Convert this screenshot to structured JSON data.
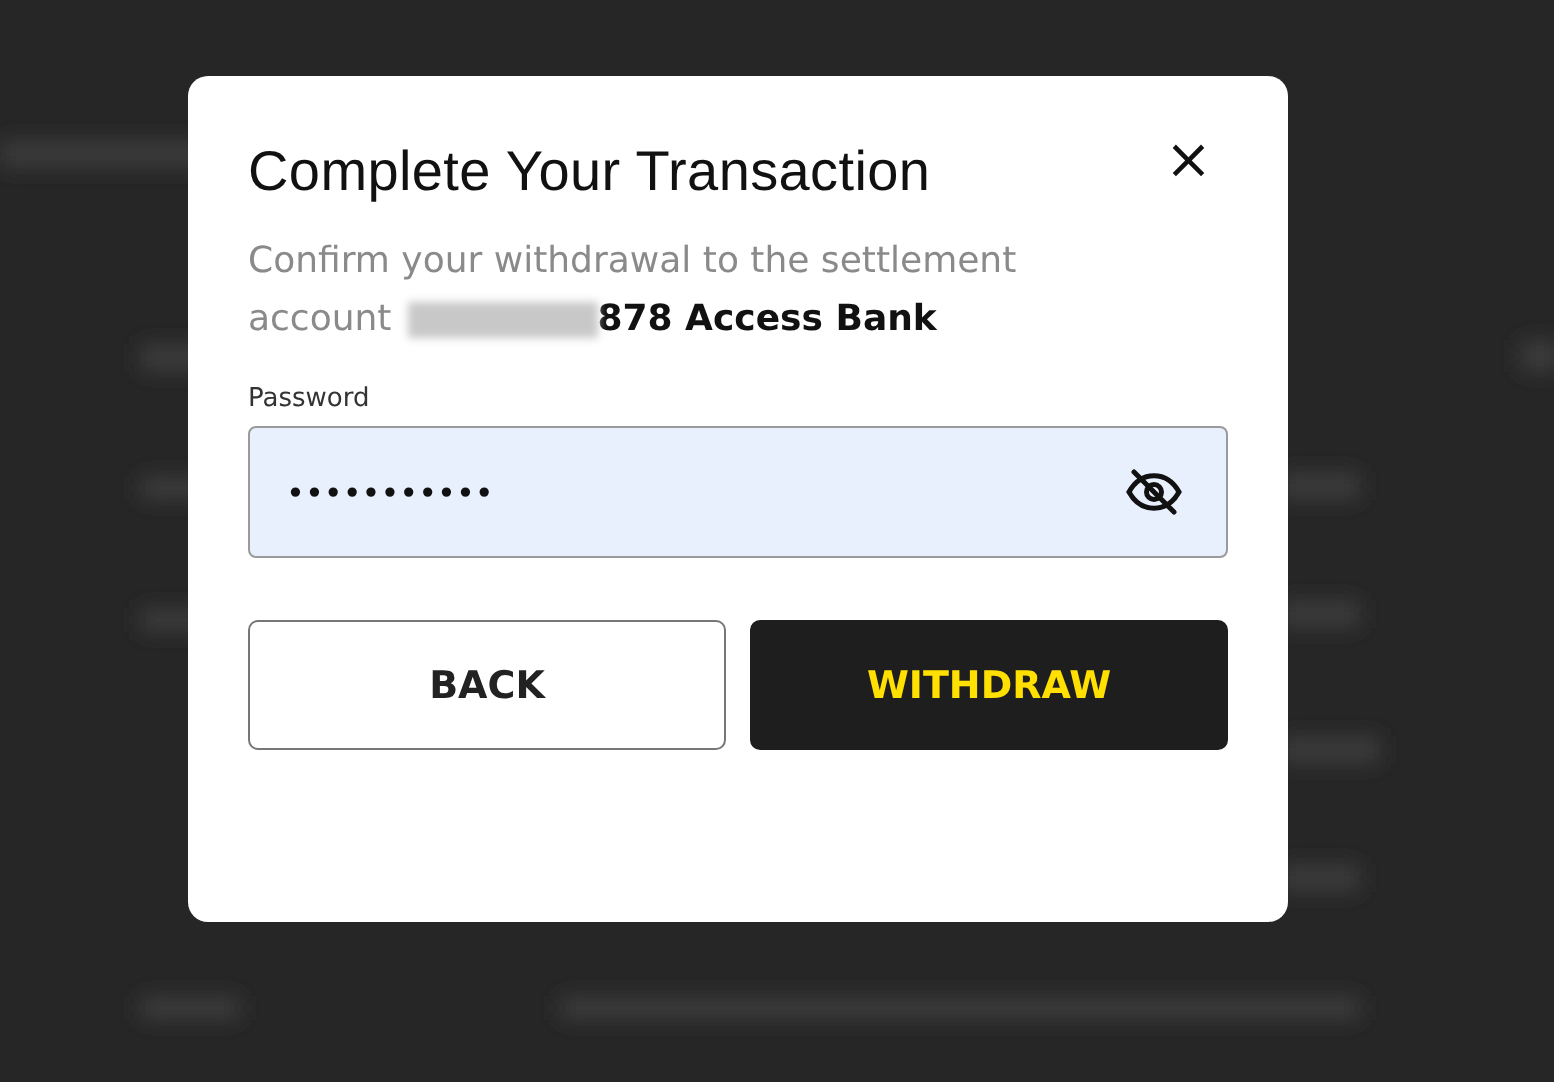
{
  "dialog": {
    "title": "Complete Your Transaction",
    "close_icon": "×",
    "message_lines": [
      "Confirm your withdrawal to the settlement",
      "account"
    ],
    "account": "878 Access Bank",
    "password": {
      "label": "Password",
      "value": "•••••••••••",
      "masked": true
    },
    "buttons": [
      {
        "kind": "secondary",
        "label": "BACK"
      },
      {
        "kind": "primary",
        "label": "WITHDRAW"
      }
    ]
  }
}
